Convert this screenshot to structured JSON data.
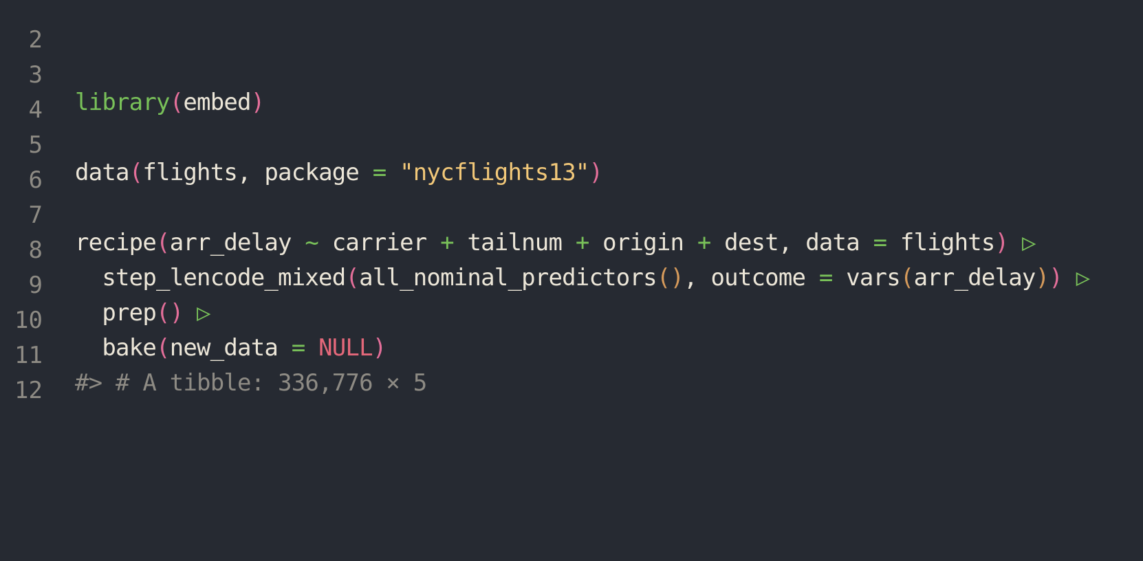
{
  "editor": {
    "lines": [
      {
        "number": "2",
        "tokens": []
      },
      {
        "number": "3",
        "tokens": [
          {
            "t": "library",
            "c": "kw-lib"
          },
          {
            "t": "(",
            "c": "paren"
          },
          {
            "t": "embed",
            "c": "plain"
          },
          {
            "t": ")",
            "c": "paren"
          }
        ]
      },
      {
        "number": "4",
        "tokens": []
      },
      {
        "number": "5",
        "tokens": [
          {
            "t": "data",
            "c": "plain"
          },
          {
            "t": "(",
            "c": "paren"
          },
          {
            "t": "flights, package ",
            "c": "plain"
          },
          {
            "t": "=",
            "c": "op"
          },
          {
            "t": " ",
            "c": "plain"
          },
          {
            "t": "\"nycflights13\"",
            "c": "str"
          },
          {
            "t": ")",
            "c": "paren"
          }
        ]
      },
      {
        "number": "6",
        "tokens": []
      },
      {
        "number": "7",
        "tokens": [
          {
            "t": "recipe",
            "c": "plain"
          },
          {
            "t": "(",
            "c": "paren"
          },
          {
            "t": "arr_delay ",
            "c": "plain"
          },
          {
            "t": "~",
            "c": "op"
          },
          {
            "t": " carrier ",
            "c": "plain"
          },
          {
            "t": "+",
            "c": "op"
          },
          {
            "t": " tailnum ",
            "c": "plain"
          },
          {
            "t": "+",
            "c": "op"
          },
          {
            "t": " origin ",
            "c": "plain"
          },
          {
            "t": "+",
            "c": "op"
          },
          {
            "t": " dest, data ",
            "c": "plain"
          },
          {
            "t": "=",
            "c": "op"
          },
          {
            "t": " flights",
            "c": "plain"
          },
          {
            "t": ")",
            "c": "paren"
          },
          {
            "t": " ",
            "c": "plain"
          },
          {
            "t": "▷",
            "c": "pipe"
          }
        ]
      },
      {
        "number": "8",
        "tokens": [
          {
            "t": "  step_lencode_mixed",
            "c": "plain"
          },
          {
            "t": "(",
            "c": "paren"
          },
          {
            "t": "all_nominal_predictors",
            "c": "plain"
          },
          {
            "t": "()",
            "c": "paren2"
          },
          {
            "t": ", outcome ",
            "c": "plain"
          },
          {
            "t": "=",
            "c": "op"
          },
          {
            "t": " vars",
            "c": "plain"
          },
          {
            "t": "(",
            "c": "paren2"
          },
          {
            "t": "arr_delay",
            "c": "plain"
          },
          {
            "t": ")",
            "c": "paren2"
          },
          {
            "t": ")",
            "c": "paren"
          },
          {
            "t": " ",
            "c": "plain"
          },
          {
            "t": "▷",
            "c": "pipe"
          }
        ]
      },
      {
        "number": "9",
        "tokens": [
          {
            "t": "  prep",
            "c": "plain"
          },
          {
            "t": "()",
            "c": "paren"
          },
          {
            "t": " ",
            "c": "plain"
          },
          {
            "t": "▷",
            "c": "pipe"
          }
        ]
      },
      {
        "number": "10",
        "tokens": [
          {
            "t": "  bake",
            "c": "plain"
          },
          {
            "t": "(",
            "c": "paren"
          },
          {
            "t": "new_data ",
            "c": "plain"
          },
          {
            "t": "=",
            "c": "op"
          },
          {
            "t": " ",
            "c": "plain"
          },
          {
            "t": "NULL",
            "c": "null"
          },
          {
            "t": ")",
            "c": "paren"
          }
        ]
      },
      {
        "number": "11",
        "tokens": [
          {
            "t": "#> # A tibble: 336,776 × 5",
            "c": "comment"
          }
        ]
      },
      {
        "number": "12",
        "tokens": []
      }
    ]
  }
}
